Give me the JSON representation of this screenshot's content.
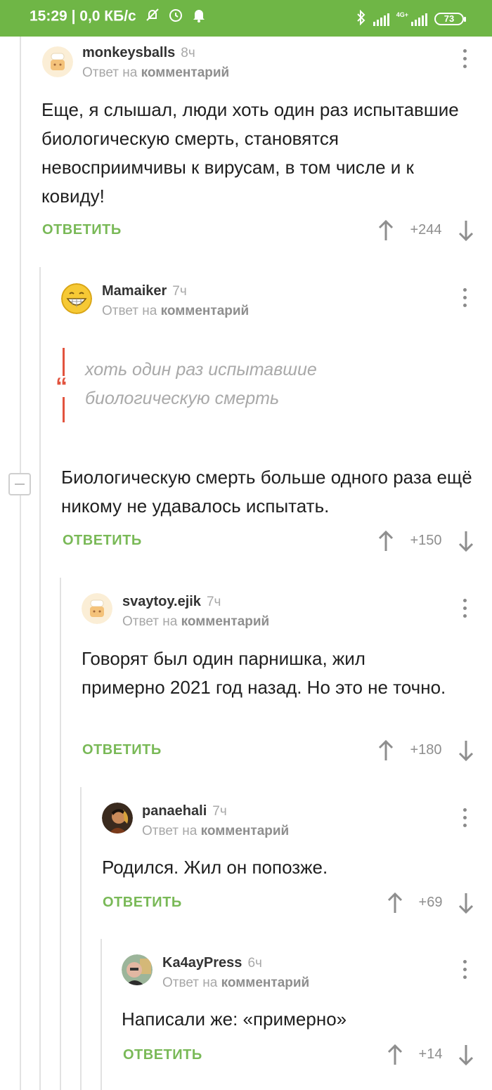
{
  "status_bar": {
    "time": "15:29",
    "network_speed": "0,0 КБ/с",
    "network_type": "4G+",
    "battery": "73",
    "icons": [
      "no-alarm-icon",
      "alarm-icon",
      "bell-icon",
      "bluetooth-icon",
      "signal-icon"
    ]
  },
  "ui": {
    "reply_prefix": "Ответ на",
    "reply_target": "комментарий",
    "reply_button": "ОТВЕТИТЬ",
    "quote_mark": "“"
  },
  "comments": [
    {
      "user": "monkeysballs",
      "time": "8ч",
      "text": "Еще, я слышал, люди хоть один раз испытавшие  биологическую смерть, становятся невосприимчивы к вирусам, в том числе и к ковиду!",
      "score": "+244"
    },
    {
      "user": "Mamaiker",
      "time": "7ч",
      "quote": "хоть один раз испытавшие биологическую смерть",
      "text": "Биологическую смерть больше одного раза ещё никому не удавалось испытать.",
      "score": "+150"
    },
    {
      "user": "svaytoy.ejik",
      "time": "7ч",
      "text": "Говорят был один парнишка, жил примерно 2021 год назад. Но это не точно.",
      "score": "+180"
    },
    {
      "user": "panaehali",
      "time": "7ч",
      "text": "Родился. Жил он попозже.",
      "score": "+69"
    },
    {
      "user": "Ka4ayPress",
      "time": "6ч",
      "text": "Написали же: «примерно»",
      "score": "+14"
    }
  ]
}
